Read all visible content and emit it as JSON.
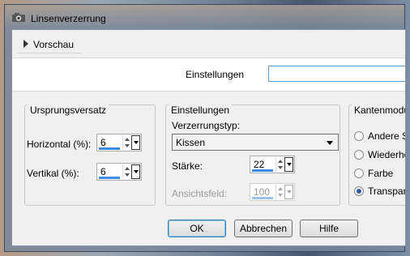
{
  "window": {
    "title": "Linsenverzerrung"
  },
  "preview": {
    "label": "Vorschau"
  },
  "settings": {
    "label": "Einstellungen",
    "preset_value": ""
  },
  "origin_group": {
    "title": "Ursprungsversatz",
    "horizontal": {
      "label": "Horizontal (%):",
      "value": "6"
    },
    "vertical": {
      "label": "Vertikal (%):",
      "value": "6"
    }
  },
  "settings_group": {
    "title": "Einstellungen",
    "distortion_type_label": "Verzerrungstyp:",
    "distortion_type_value": "Kissen",
    "strength": {
      "label": "Stärke:",
      "value": "22"
    },
    "field_of_view": {
      "label": "Ansichtsfeld:",
      "value": "100"
    }
  },
  "edge_group": {
    "title": "Kantenmodus",
    "options": [
      {
        "label": "Andere Se",
        "selected": false
      },
      {
        "label": "Wiederhol",
        "selected": false
      },
      {
        "label": "Farbe",
        "selected": false
      },
      {
        "label": "Transpare",
        "selected": true
      }
    ]
  },
  "buttons": {
    "ok": "OK",
    "cancel": "Abbrechen",
    "help": "Hilfe"
  },
  "colors": {
    "accent": "#3c8de0",
    "selected_radio": "#2a5ea8",
    "input_focus": "#5b9bd5"
  }
}
